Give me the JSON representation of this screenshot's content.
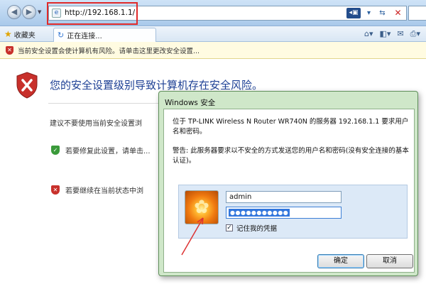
{
  "browser": {
    "address_url": "http://192.168.1.1/",
    "favorites_label": "收藏夹",
    "tab_label": "正在连接...",
    "infobar_text": "当前安全设置会使计算机有风险。请单击这里更改安全设置..."
  },
  "page": {
    "warning_title": "您的安全设置级别导致计算机存在安全风险。",
    "advice_text": "建议不要使用当前安全设置浏",
    "option_fix": "若要修复此设置，请单击...",
    "option_continue": "若要继续在当前状态中浏"
  },
  "dialog": {
    "title": "Windows 安全",
    "message_line": "位于 TP-LINK Wireless N Router WR740N 的服务器 192.168.1.1 要求用户名和密码。",
    "warning_line": "警告: 此服务器要求以不安全的方式发送您的用户名和密码(没有安全连接的基本认证)。",
    "username_value": "admin",
    "password_value": "●●●●●●●●●●●",
    "remember_label": "记住我的凭据",
    "ok_label": "确定",
    "cancel_label": "取消"
  },
  "colors": {
    "accent_red": "#c8302b",
    "title_blue": "#1c3f94",
    "dialog_frame": "#cfe7c9",
    "selection_blue": "#3377dd"
  },
  "icons": [
    "back-icon",
    "forward-icon",
    "page-icon",
    "certificate-icon",
    "refresh-icon",
    "stop-icon",
    "favorites-star-icon",
    "loading-icon",
    "home-icon",
    "rss-icon",
    "print-icon",
    "shield-warning-icon",
    "shield-ok-icon",
    "shield-x-icon",
    "user-avatar-icon",
    "checkbox-icon"
  ]
}
